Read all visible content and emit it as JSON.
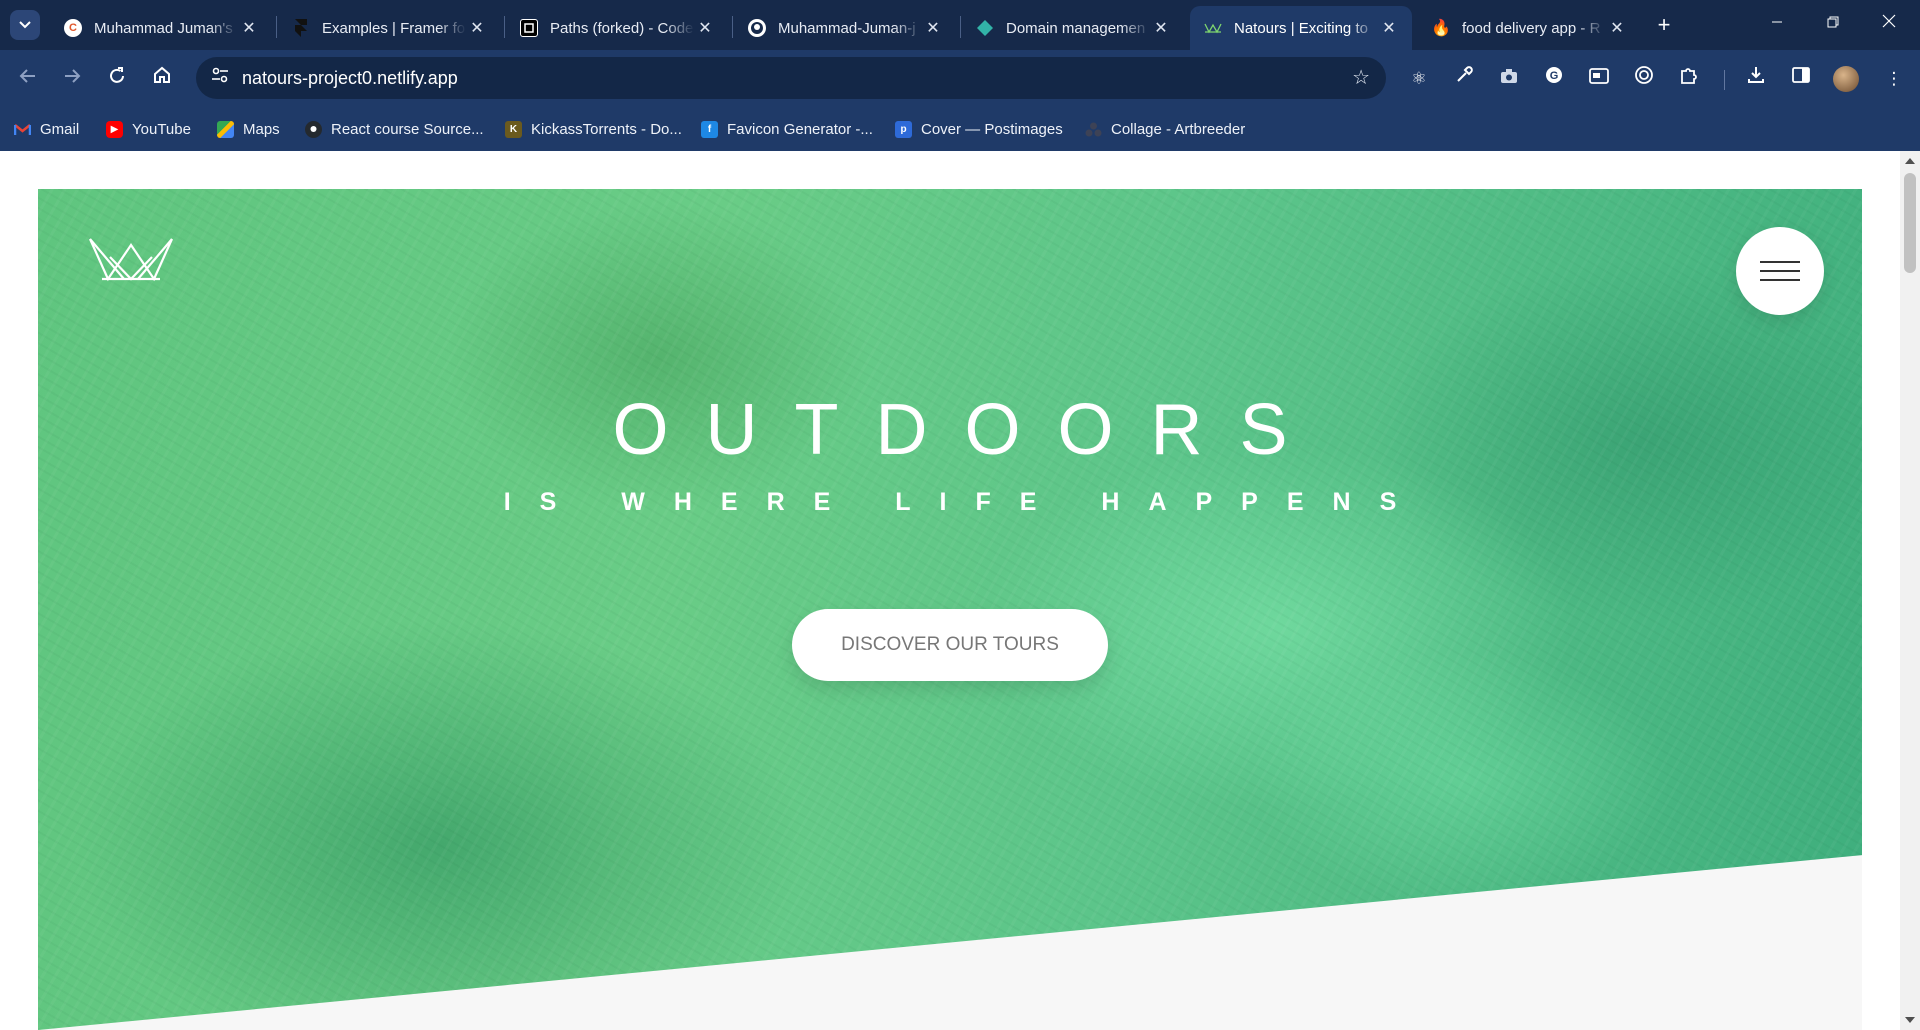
{
  "browser": {
    "tabs": [
      {
        "title": "Muhammad Juman's",
        "favicon": "framer-c-icon",
        "active": false
      },
      {
        "title": "Examples | Framer for",
        "favicon": "framer-icon",
        "active": false
      },
      {
        "title": "Paths (forked) - Code",
        "favicon": "codesandbox-icon",
        "active": false
      },
      {
        "title": "Muhammad-Juman-j",
        "favicon": "github-icon",
        "active": false
      },
      {
        "title": "Domain managemen",
        "favicon": "netlify-diamond-icon",
        "active": false
      },
      {
        "title": "Natours | Exciting to",
        "favicon": "natours-logo-icon",
        "active": true
      },
      {
        "title": "food delivery app - R",
        "favicon": "firebase-icon",
        "active": false
      }
    ],
    "address": "natours-project0.netlify.app",
    "bookmarks": [
      {
        "label": "Gmail",
        "icon": "gmail-icon",
        "color": "#ea4335"
      },
      {
        "label": "YouTube",
        "icon": "youtube-icon",
        "color": "#ff0000"
      },
      {
        "label": "Maps",
        "icon": "maps-icon",
        "color": "#34a853"
      },
      {
        "label": "React course Source...",
        "icon": "github-icon",
        "color": "#24292e"
      },
      {
        "label": "KickassTorrents - Do...",
        "icon": "kickass-icon",
        "color": "#6b5a1e"
      },
      {
        "label": "Favicon Generator -...",
        "icon": "favicon-generator-icon",
        "color": "#1e88e5"
      },
      {
        "label": "Cover — Postimages",
        "icon": "postimages-icon",
        "color": "#2e6ad8"
      },
      {
        "label": "Collage - Artbreeder",
        "icon": "artbreeder-icon",
        "color": "#3a3a4a"
      }
    ]
  },
  "hero": {
    "title_main": "OUTDOORS",
    "title_sub": "IS WHERE LIFE HAPPENS",
    "cta_label": "DISCOVER OUR TOURS",
    "logo_icon": "natours-crown-logo-icon",
    "menu_icon": "hamburger-menu-icon",
    "colors": {
      "green_light": "#7ed56f",
      "green_dark": "#28b485",
      "text": "#777777"
    }
  }
}
